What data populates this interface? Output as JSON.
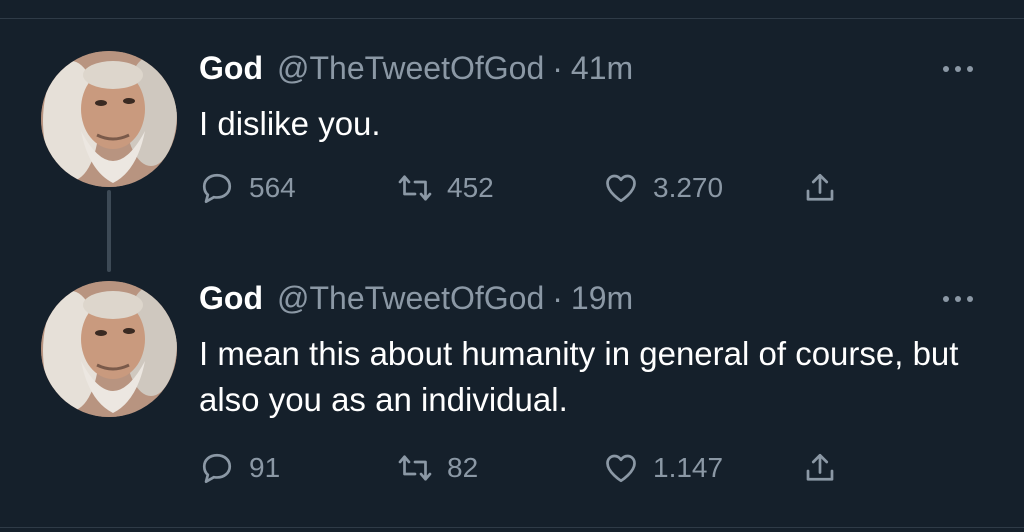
{
  "tweets": [
    {
      "name": "God",
      "handle": "@TheTweetOfGod",
      "separator": "·",
      "time": "41m",
      "text": "I dislike you.",
      "replies": "564",
      "retweets": "452",
      "likes": "3.270"
    },
    {
      "name": "God",
      "handle": "@TheTweetOfGod",
      "separator": "·",
      "time": "19m",
      "text": "I mean this about humanity in general of course, but also you as an individual.",
      "replies": "91",
      "retweets": "82",
      "likes": "1.147"
    }
  ],
  "icons": {
    "reply": "reply-icon",
    "retweet": "retweet-icon",
    "like": "heart-icon",
    "share": "share-icon",
    "more": "more-icon"
  },
  "colors": {
    "background": "#15202b",
    "secondary_text": "#8b98a5",
    "primary_text": "#ffffff",
    "divider": "#2f3b47"
  }
}
